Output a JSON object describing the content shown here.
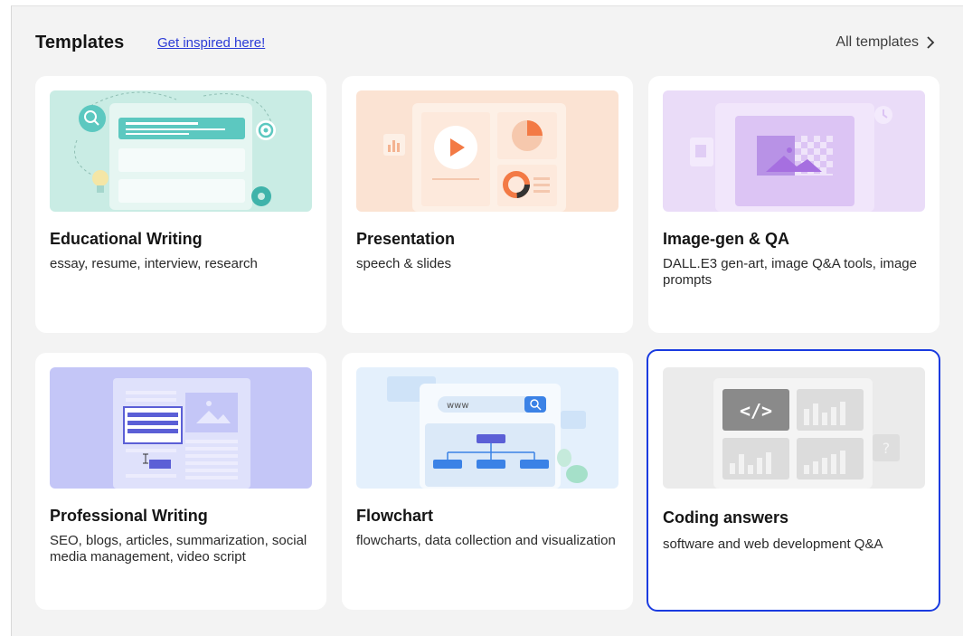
{
  "header": {
    "title": "Templates",
    "inspired_link": "Get inspired here!",
    "all_templates": "All templates"
  },
  "cards": [
    {
      "title": "Educational Writing",
      "description": "essay, resume, interview, research",
      "thumb_color": "#c9ece4"
    },
    {
      "title": "Presentation",
      "description": "speech & slides",
      "thumb_color": "#fbe3d3"
    },
    {
      "title": "Image-gen & QA",
      "description": "DALL.E3 gen-art, image Q&A tools, image prompts",
      "thumb_color": "#eadcf8"
    },
    {
      "title": "Professional Writing",
      "description": "SEO, blogs, articles, summarization, social media management, video script",
      "thumb_color": "#c4c6f7"
    },
    {
      "title": "Flowchart",
      "description": "flowcharts, data collection and visualization",
      "thumb_color": "#e4f0fc"
    },
    {
      "title": "Coding answers",
      "description": "software and web development Q&A",
      "thumb_color": "#ebebeb",
      "selected": true
    }
  ],
  "colors": {
    "link": "#2b3bd6",
    "selected_border": "#1a3be0",
    "panel_bg": "#f3f3f3"
  }
}
